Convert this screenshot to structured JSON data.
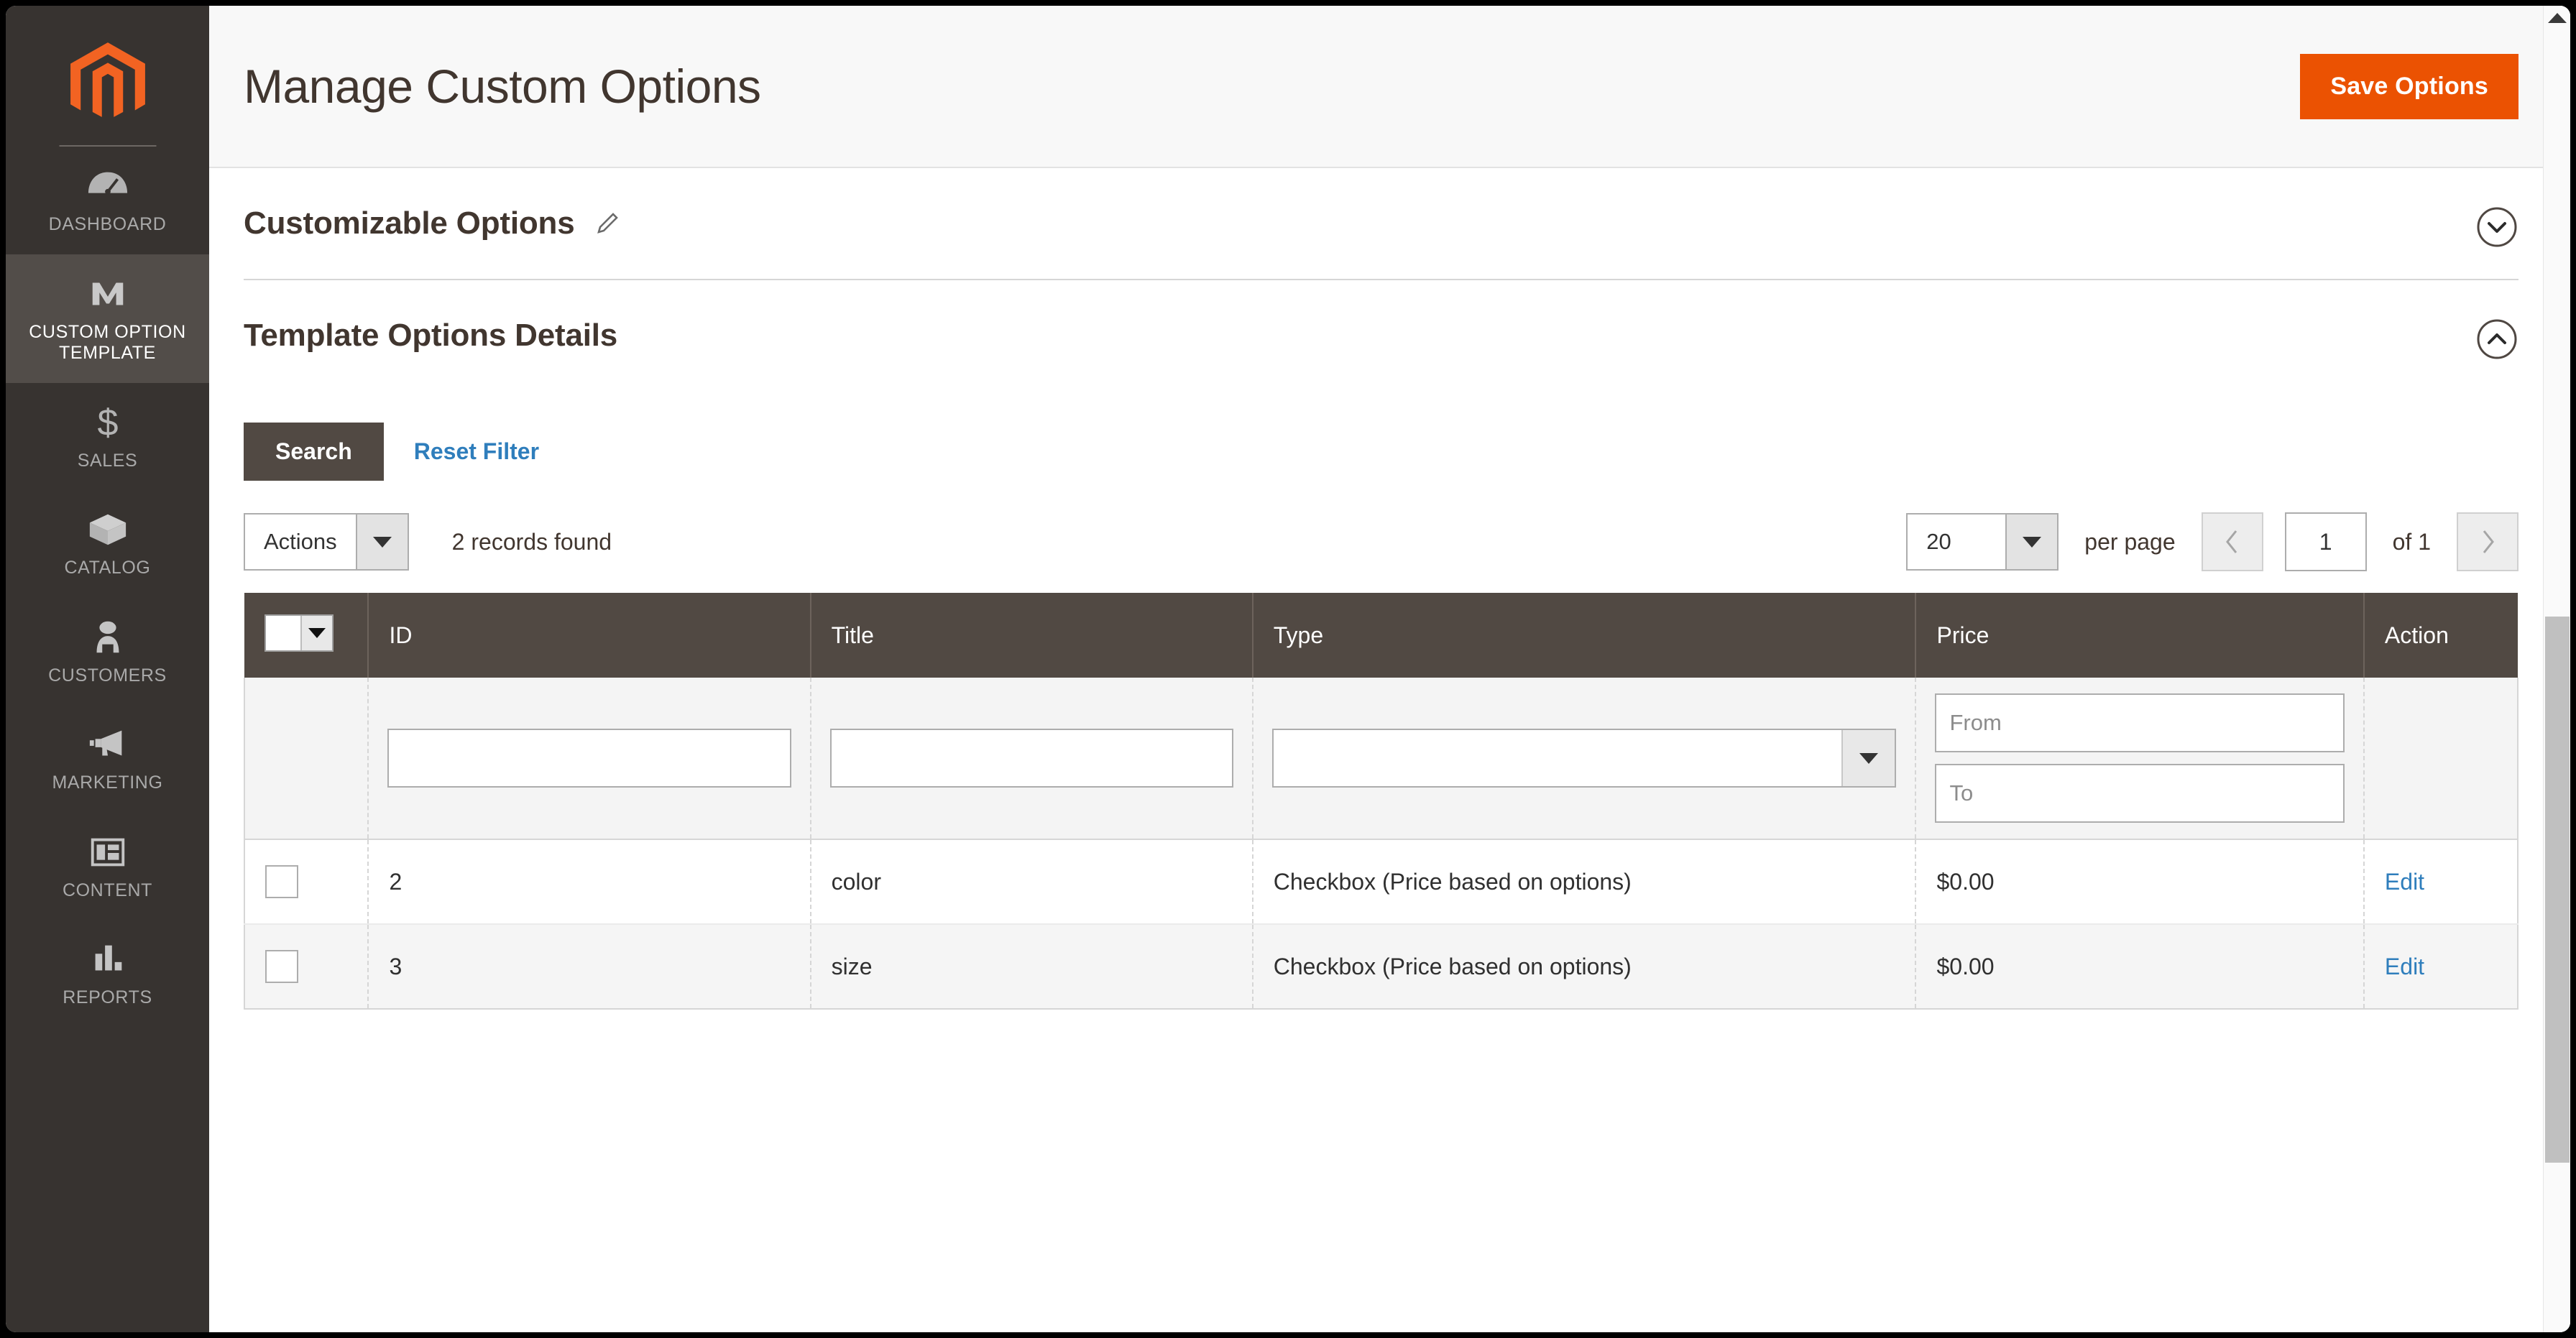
{
  "header": {
    "title": "Manage Custom Options",
    "save_label": "Save Options"
  },
  "sidebar": {
    "logo_name": "magento-logo",
    "items": [
      {
        "label": "DASHBOARD",
        "icon": "dashboard-icon",
        "active": false
      },
      {
        "label": "CUSTOM OPTION TEMPLATE",
        "icon": "custom-option-template-icon",
        "active": true
      },
      {
        "label": "SALES",
        "icon": "sales-icon",
        "active": false
      },
      {
        "label": "CATALOG",
        "icon": "catalog-icon",
        "active": false
      },
      {
        "label": "CUSTOMERS",
        "icon": "customers-icon",
        "active": false
      },
      {
        "label": "MARKETING",
        "icon": "marketing-icon",
        "active": false
      },
      {
        "label": "CONTENT",
        "icon": "content-icon",
        "active": false
      },
      {
        "label": "REPORTS",
        "icon": "reports-icon",
        "active": false
      }
    ]
  },
  "sections": {
    "customizable_options": {
      "title": "Customizable Options",
      "edit_icon": "pencil-icon",
      "toggle_icon": "chevron-down-circle-icon"
    },
    "template_options_details": {
      "title": "Template Options Details",
      "toggle_icon": "chevron-up-circle-icon"
    }
  },
  "grid": {
    "search_label": "Search",
    "reset_filter_label": "Reset Filter",
    "actions_label": "Actions",
    "records_found": "2 records found",
    "per_page_value": "20",
    "per_page_label": "per page",
    "page_value": "1",
    "page_of": "of 1",
    "prev_icon": "chevron-left-icon",
    "next_icon": "chevron-right-icon",
    "columns": [
      "ID",
      "Title",
      "Type",
      "Price",
      "Action"
    ],
    "filters": {
      "id": "",
      "id_placeholder": "",
      "title": "",
      "title_placeholder": "",
      "type": "",
      "price_from_placeholder": "From",
      "price_to_placeholder": "To",
      "price_from": "",
      "price_to": ""
    },
    "rows": [
      {
        "id": "2",
        "title": "color",
        "type": "Checkbox (Price based on options)",
        "price": "$0.00",
        "action": "Edit"
      },
      {
        "id": "3",
        "title": "size",
        "type": "Checkbox (Price based on options)",
        "price": "$0.00",
        "action": "Edit"
      }
    ]
  },
  "colors": {
    "brand_orange": "#eb5202",
    "sidebar_bg": "#373330",
    "sidebar_active": "#524d49",
    "table_header": "#514943",
    "link_blue": "#2f7ebc"
  }
}
